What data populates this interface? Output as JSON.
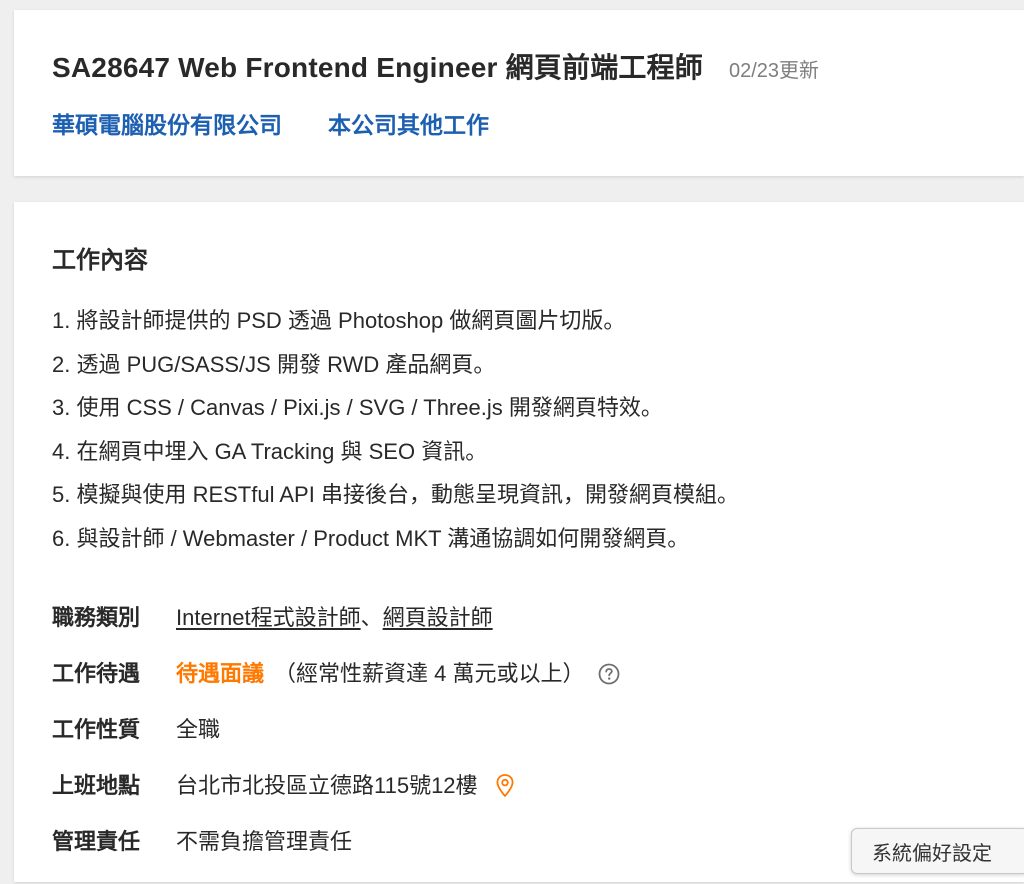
{
  "header": {
    "job_title": "SA28647 Web Frontend Engineer 網頁前端工程師",
    "update_date": "02/23更新",
    "company_link": "華碩電腦股份有限公司",
    "other_jobs_link": "本公司其他工作"
  },
  "job_content": {
    "section_title": "工作內容",
    "items": [
      "1. 將設計師提供的 PSD 透過 Photoshop 做網頁圖片切版。",
      "2. 透過 PUG/SASS/JS 開發 RWD 產品網頁。",
      "3. 使用 CSS / Canvas / Pixi.js / SVG / Three.js 開發網頁特效。",
      "4. 在網頁中埋入 GA Tracking 與 SEO 資訊。",
      "5. 模擬與使用 RESTful API 串接後台，動態呈現資訊，開發網頁模組。",
      "6. 與設計師 / Webmaster / Product MKT 溝通協調如何開發網頁。"
    ]
  },
  "details": {
    "category": {
      "label": "職務類別",
      "link_1": "Internet程式設計師",
      "separator": "、",
      "link_2": "網頁設計師"
    },
    "salary": {
      "label": "工作待遇",
      "value": "待遇面議",
      "note": "（經常性薪資達 4 萬元或以上）",
      "icon": "question-circle-icon"
    },
    "job_type": {
      "label": "工作性質",
      "value": "全職"
    },
    "location": {
      "label": "上班地點",
      "value": "台北市北投區立德路115號12樓",
      "icon": "map-pin-icon"
    },
    "management": {
      "label": "管理責任",
      "value": "不需負擔管理責任"
    }
  },
  "overlay": {
    "preferences_button": "系統偏好設定"
  },
  "colors": {
    "link_blue": "#1d5fb0",
    "salary_orange": "#ff7800",
    "text": "#292929",
    "muted": "#7e7e7e",
    "background": "#efefef"
  }
}
